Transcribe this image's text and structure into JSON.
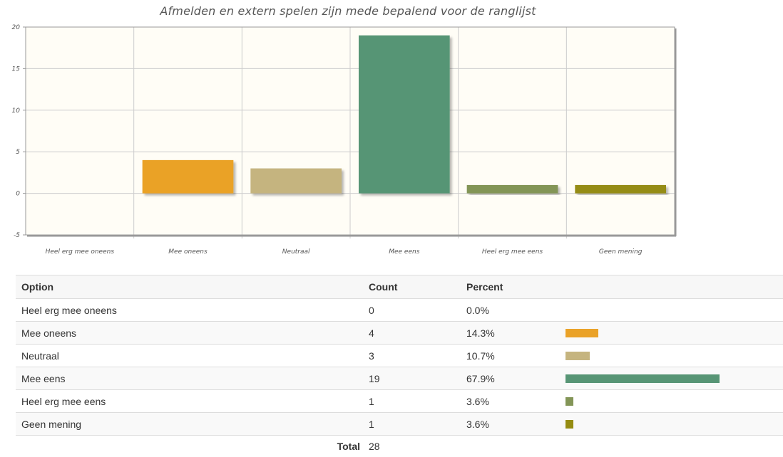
{
  "chart_data": {
    "type": "bar",
    "title": "Afmelden en extern spelen zijn mede bepalend voor de ranglijst",
    "categories": [
      "Heel erg mee oneens",
      "Mee oneens",
      "Neutraal",
      "Mee eens",
      "Heel erg mee eens",
      "Geen mening"
    ],
    "values": [
      0,
      4,
      3,
      19,
      1,
      1
    ],
    "colors": [
      "#4bb2c5",
      "#eaa228",
      "#c5b47f",
      "#579575",
      "#839557",
      "#958c12"
    ],
    "ylim": [
      -5,
      20
    ],
    "yticks": [
      -5,
      0,
      5,
      10,
      15,
      20
    ],
    "xlabel": "",
    "ylabel": "",
    "grid": true,
    "background": "#fffdf6"
  },
  "table": {
    "headers": {
      "option": "Option",
      "count": "Count",
      "percent": "Percent"
    },
    "rows": [
      {
        "option": "Heel erg mee oneens",
        "count": "0",
        "percent": "0.0%",
        "fraction": 0.0,
        "color": "#4bb2c5"
      },
      {
        "option": "Mee oneens",
        "count": "4",
        "percent": "14.3%",
        "fraction": 0.143,
        "color": "#eaa228"
      },
      {
        "option": "Neutraal",
        "count": "3",
        "percent": "10.7%",
        "fraction": 0.107,
        "color": "#c5b47f"
      },
      {
        "option": "Mee eens",
        "count": "19",
        "percent": "67.9%",
        "fraction": 0.679,
        "color": "#579575"
      },
      {
        "option": "Heel erg mee eens",
        "count": "1",
        "percent": "3.6%",
        "fraction": 0.036,
        "color": "#839557"
      },
      {
        "option": "Geen mening",
        "count": "1",
        "percent": "3.6%",
        "fraction": 0.036,
        "color": "#958c12"
      }
    ],
    "total_label": "Total",
    "total_value": "28"
  }
}
